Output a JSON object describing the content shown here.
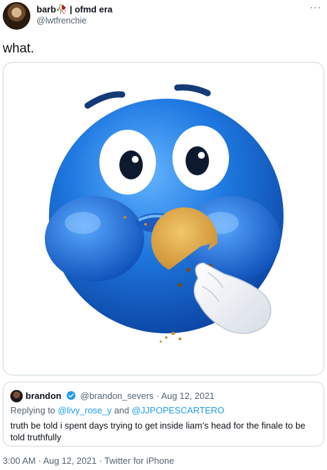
{
  "tweet": {
    "display_name": "barb🥀 | ofmd era",
    "handle": "@lwtfrenchie",
    "more_glyph": "···",
    "text": "what."
  },
  "media": {
    "description_icon": "blue-emoji-eating-cookie"
  },
  "quote": {
    "name": "brandon",
    "handle": "@brandon_severs",
    "separator": "·",
    "date": "Aug 12, 2021",
    "replying_prefix": "Replying to",
    "reply_to_1": "@livy_rose_y",
    "reply_and": "and",
    "reply_to_2": "@JJPOPESCARTERO",
    "text": "truth be told i spent days trying to get inside liam’s head for the finale to be told truthfully"
  },
  "meta": {
    "time": "3:00 AM",
    "sep1": "·",
    "date": "Aug 12, 2021",
    "sep2": "·",
    "source": "Twitter for iPhone"
  },
  "colors": {
    "link": "#1d9bf0",
    "secondary_text": "#536471",
    "border": "#cfd9de",
    "emoji_blue": "#1f6fd6"
  }
}
